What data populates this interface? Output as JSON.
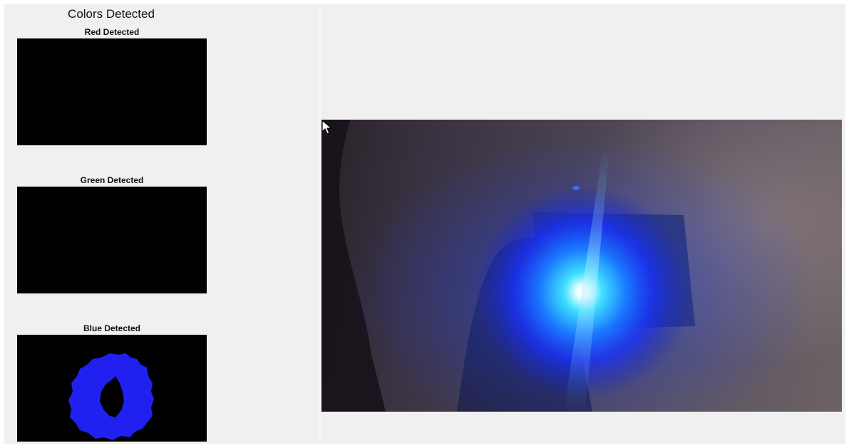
{
  "left_figure": {
    "suptitle": "Colors Detected",
    "panels": [
      {
        "title": "Red Detected",
        "mask": "none"
      },
      {
        "title": "Green Detected",
        "mask": "none"
      },
      {
        "title": "Blue Detected",
        "mask": "blue-ring"
      }
    ]
  },
  "right_figure": {
    "content": "webcam-frame",
    "light_color": "#1e3cff"
  },
  "colors": {
    "window_bg": "#f0f0f0",
    "axes_bg": "#000000",
    "mask_blue": "#2020f0",
    "glow_cyan": "#3fe0ff"
  },
  "icons": [
    "mouse-pointer-icon"
  ]
}
